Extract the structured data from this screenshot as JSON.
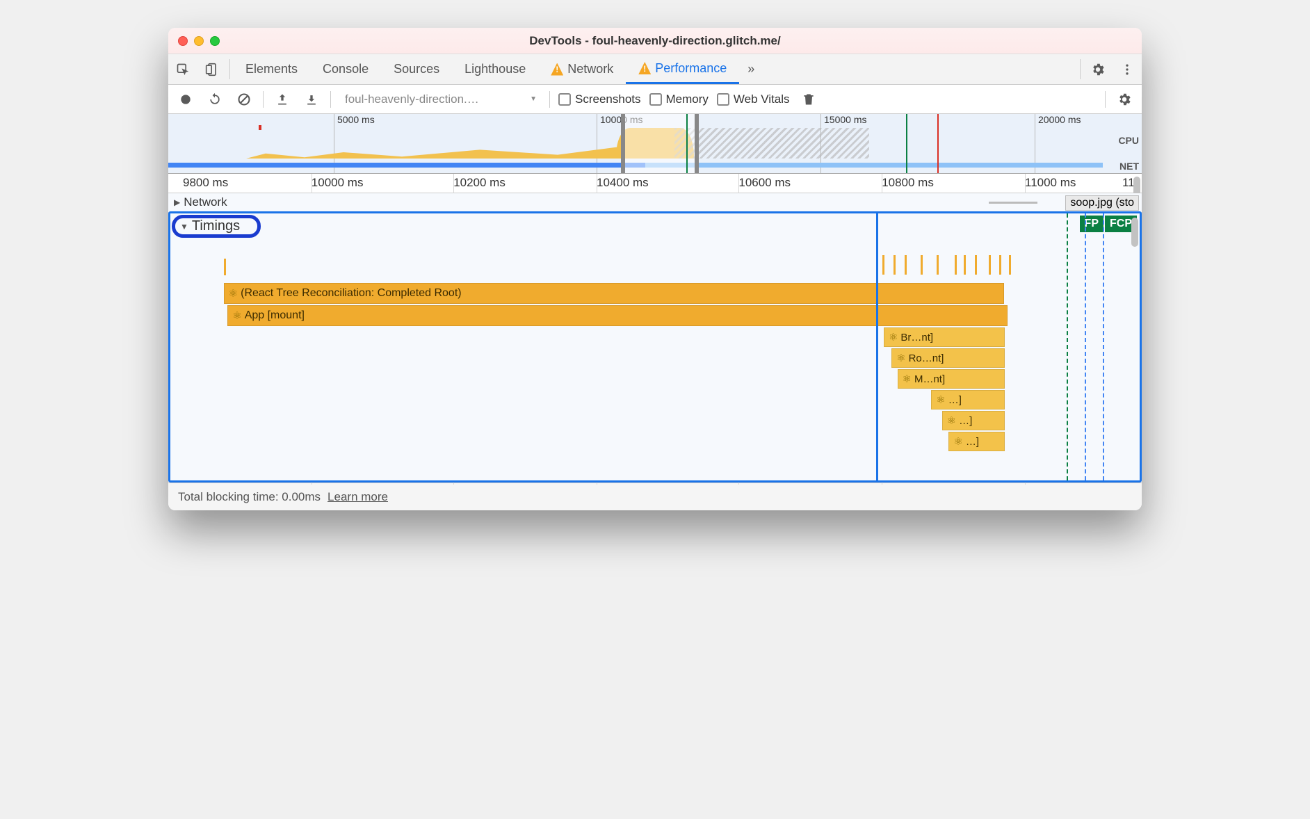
{
  "window_title": "DevTools - foul-heavenly-direction.glitch.me/",
  "tabs": {
    "elements": "Elements",
    "console": "Console",
    "sources": "Sources",
    "lighthouse": "Lighthouse",
    "network": "Network",
    "performance": "Performance",
    "more": "»"
  },
  "toolbar": {
    "recording_select": "foul-heavenly-direction.…",
    "chk_screenshots": "Screenshots",
    "chk_memory": "Memory",
    "chk_webvitals": "Web Vitals"
  },
  "overview": {
    "ticks": [
      "5000 ms",
      "10000 ms",
      "15000 ms",
      "20000 ms"
    ],
    "cpu_label": "CPU",
    "net_label": "NET"
  },
  "ruler": [
    "9800 ms",
    "10000 ms",
    "10200 ms",
    "10400 ms",
    "10600 ms",
    "10800 ms",
    "11000 ms",
    "11"
  ],
  "rows": {
    "network": "Network",
    "network_item": "soop.jpg (sto",
    "timings": "Timings",
    "fp": "FP",
    "fcp": "FCP"
  },
  "flames": {
    "root": "(React Tree Reconciliation: Completed Root)",
    "app": "App [mount]",
    "br": "Br…nt]",
    "ro": "Ro…nt]",
    "m": "M…nt]",
    "d1": "…]",
    "d2": "…]",
    "d3": "…]"
  },
  "footer": {
    "text": "Total blocking time: 0.00ms",
    "link": "Learn more"
  }
}
